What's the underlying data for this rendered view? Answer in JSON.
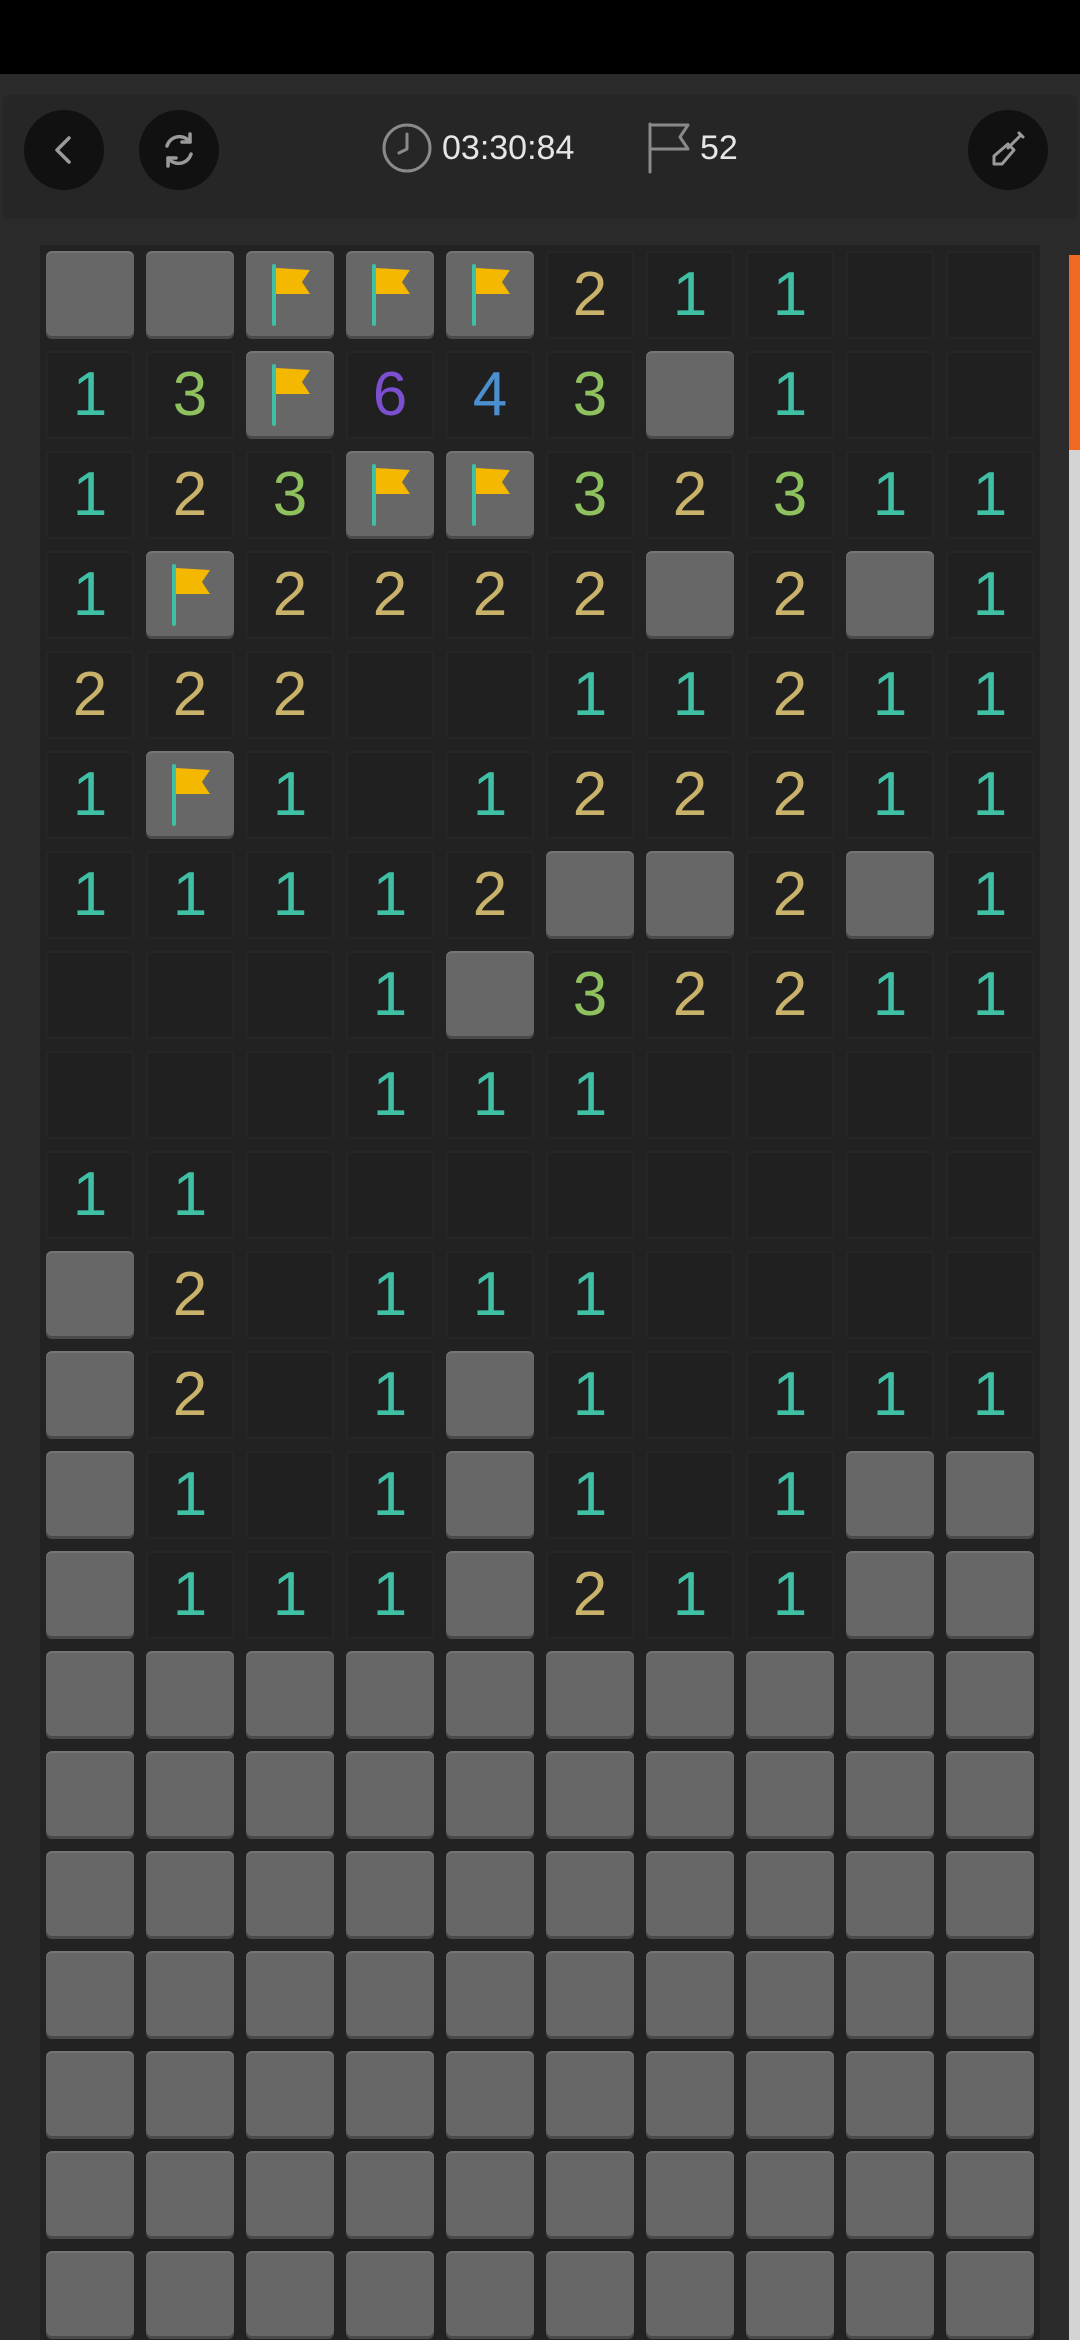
{
  "header": {
    "timer": "03:30:84",
    "flags_remaining": "52"
  },
  "colors": {
    "1": "#3fbfa4",
    "2": "#c9b36a",
    "3": "#8fc25e",
    "4": "#4a8fd0",
    "6": "#7b4fd0",
    "flag": "#f5b800",
    "pole": "#3fbfa4"
  },
  "board": {
    "columns": 10,
    "rows": [
      [
        "C",
        "C",
        "F",
        "F",
        "F",
        "2",
        "1",
        "1",
        "",
        ""
      ],
      [
        "1",
        "3",
        "F",
        "6",
        "4",
        "3",
        "C",
        "1",
        "",
        ""
      ],
      [
        "1",
        "2",
        "3",
        "F",
        "F",
        "3",
        "2",
        "3",
        "1",
        "1"
      ],
      [
        "1",
        "F",
        "2",
        "2",
        "2",
        "2",
        "C",
        "2",
        "C",
        "1"
      ],
      [
        "2",
        "2",
        "2",
        "",
        "",
        "1",
        "1",
        "2",
        "1",
        "1"
      ],
      [
        "1",
        "F",
        "1",
        "",
        "1",
        "2",
        "2",
        "2",
        "1",
        "1"
      ],
      [
        "1",
        "1",
        "1",
        "1",
        "2",
        "C",
        "C",
        "2",
        "C",
        "1"
      ],
      [
        "",
        "",
        "",
        "1",
        "C",
        "3",
        "2",
        "2",
        "1",
        "1"
      ],
      [
        "",
        "",
        "",
        "1",
        "1",
        "1",
        "",
        "",
        "",
        ""
      ],
      [
        "1",
        "1",
        "",
        "",
        "",
        "",
        "",
        "",
        "",
        ""
      ],
      [
        "C",
        "2",
        "",
        "1",
        "1",
        "1",
        "",
        "",
        "",
        ""
      ],
      [
        "C",
        "2",
        "",
        "1",
        "C",
        "1",
        "",
        "1",
        "1",
        "1"
      ],
      [
        "C",
        "1",
        "",
        "1",
        "C",
        "1",
        "",
        "1",
        "C",
        "C"
      ],
      [
        "C",
        "1",
        "1",
        "1",
        "C",
        "2",
        "1",
        "1",
        "C",
        "C"
      ],
      [
        "C",
        "C",
        "C",
        "C",
        "C",
        "C",
        "C",
        "C",
        "C",
        "C"
      ],
      [
        "C",
        "C",
        "C",
        "C",
        "C",
        "C",
        "C",
        "C",
        "C",
        "C"
      ],
      [
        "C",
        "C",
        "C",
        "C",
        "C",
        "C",
        "C",
        "C",
        "C",
        "C"
      ],
      [
        "C",
        "C",
        "C",
        "C",
        "C",
        "C",
        "C",
        "C",
        "C",
        "C"
      ],
      [
        "C",
        "C",
        "C",
        "C",
        "C",
        "C",
        "C",
        "C",
        "C",
        "C"
      ],
      [
        "C",
        "C",
        "C",
        "C",
        "C",
        "C",
        "C",
        "C",
        "C",
        "C"
      ],
      [
        "C",
        "C",
        "C",
        "C",
        "C",
        "C",
        "C",
        "C",
        "C",
        "C"
      ]
    ]
  },
  "icons": {
    "back": "chevron-left-icon",
    "restart": "restart-icon",
    "timer": "clock-icon",
    "flag": "flag-icon",
    "dig": "shovel-icon"
  }
}
